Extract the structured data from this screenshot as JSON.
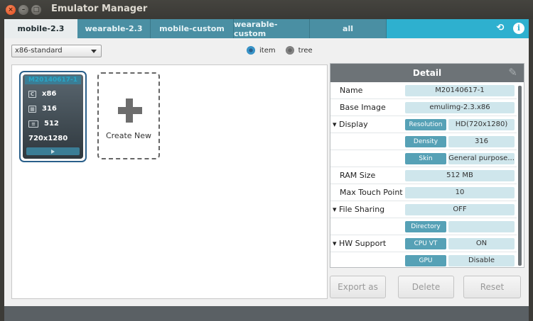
{
  "window": {
    "title": "Emulator Manager"
  },
  "tabs": [
    {
      "label": "mobile-2.3",
      "active": true
    },
    {
      "label": "wearable-2.3"
    },
    {
      "label": "mobile-custom"
    },
    {
      "label": "wearable-custom"
    },
    {
      "label": "all"
    }
  ],
  "toolbar": {
    "refresh_icon": "refresh-icon",
    "info_icon": "info-icon"
  },
  "filter": {
    "selected": "x86-standard"
  },
  "view_mode": {
    "item_label": "item",
    "tree_label": "tree",
    "selected": "item"
  },
  "emulators": [
    {
      "name": "M20140617-1",
      "cpu": "x86",
      "density": "316",
      "ram": "512",
      "resolution": "720x1280"
    }
  ],
  "create_new": {
    "label": "Create New"
  },
  "detail": {
    "title": "Detail",
    "name_key": "Name",
    "name_val": "M20140617-1",
    "image_key": "Base Image",
    "image_val": "emulimg-2.3.x86",
    "display_key": "Display",
    "resolution_lbl": "Resolution",
    "resolution_val": "HD(720x1280)",
    "density_lbl": "Density",
    "density_val": "316",
    "skin_lbl": "Skin",
    "skin_val": "General purpose...",
    "ram_key": "RAM Size",
    "ram_val": "512 MB",
    "touch_key": "Max Touch Point",
    "touch_val": "10",
    "share_key": "File Sharing",
    "share_val": "OFF",
    "dir_lbl": "Directory",
    "dir_val": "",
    "hw_key": "HW Support",
    "cpuvt_lbl": "CPU VT",
    "cpuvt_val": "ON",
    "gpu_lbl": "GPU",
    "gpu_val": "Disable"
  },
  "actions": {
    "export": "Export as",
    "delete": "Delete",
    "reset": "Reset"
  },
  "colors": {
    "accent": "#2eb0cf",
    "label_bg": "#56a1b6",
    "value_bg": "#cfe6ec",
    "header": "#6d7377"
  }
}
